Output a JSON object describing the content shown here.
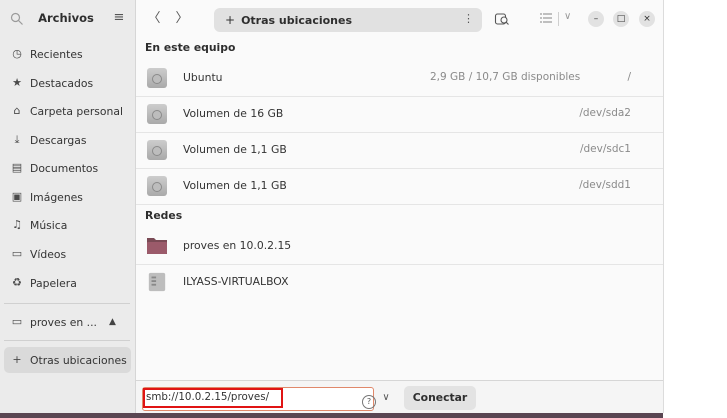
{
  "sidebar": {
    "title": "Archivos",
    "items": [
      {
        "label": "Recientes",
        "icon": "clock-icon"
      },
      {
        "label": "Destacados",
        "icon": "star-icon"
      },
      {
        "label": "Carpeta personal",
        "icon": "home-icon"
      },
      {
        "label": "Descargas",
        "icon": "download-icon"
      },
      {
        "label": "Documentos",
        "icon": "document-icon"
      },
      {
        "label": "Imágenes",
        "icon": "image-icon"
      },
      {
        "label": "Música",
        "icon": "music-icon"
      },
      {
        "label": "Vídeos",
        "icon": "video-icon"
      },
      {
        "label": "Papelera",
        "icon": "trash-icon"
      }
    ],
    "mounts": [
      {
        "label": "proves en ...",
        "icon": "network-folder-icon"
      }
    ],
    "other_locations": "Otras ubicaciones"
  },
  "header": {
    "path_label": "Otras ubicaciones"
  },
  "sections": {
    "this_computer": "En este equipo",
    "networks": "Redes"
  },
  "volumes": [
    {
      "name": "Ubuntu",
      "info": "2,9 GB / 10,7 GB disponibles",
      "path": "/"
    },
    {
      "name": "Volumen de 16 GB",
      "info": "",
      "path": "/dev/sda2"
    },
    {
      "name": "Volumen de 1,1 GB",
      "info": "",
      "path": "/dev/sdc1"
    },
    {
      "name": "Volumen de 1,1 GB",
      "info": "",
      "path": "/dev/sdd1"
    }
  ],
  "networks": [
    {
      "name": "proves en 10.0.2.15",
      "icon": "network-folder-icon"
    },
    {
      "name": "ILYASS-VIRTUALBOX",
      "icon": "computer-icon"
    }
  ],
  "bottom": {
    "address_value": "smb://10.0.2.15/proves/",
    "connect_label": "Conectar"
  }
}
